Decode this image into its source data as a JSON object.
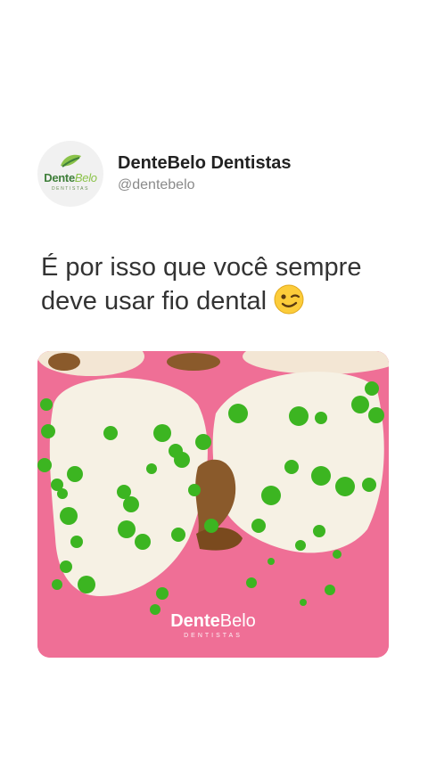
{
  "account": {
    "avatar_logo_part1": "Dente",
    "avatar_logo_part2": "Belo",
    "avatar_logo_sub": "DENTISTAS",
    "name": "DenteBelo Dentistas",
    "handle": "@dentebelo"
  },
  "post": {
    "text": "É por isso que você sempre deve usar fio dental",
    "emoji": "winking-face"
  },
  "media": {
    "description_icon": "teeth-with-germs-illustration",
    "brand_part1": "Dente",
    "brand_part2": "Belo",
    "brand_sub": "DENTISTAS",
    "colors": {
      "gum": "#ef6f96",
      "tooth": "#f6f1e4",
      "germ": "#3cb521",
      "plaque": "#8a5a2b"
    }
  },
  "colors": {
    "brand_dark_green": "#3f7f3a",
    "brand_light_green": "#8bc34a",
    "text_primary": "#222222",
    "text_secondary": "#8a8a8a"
  }
}
